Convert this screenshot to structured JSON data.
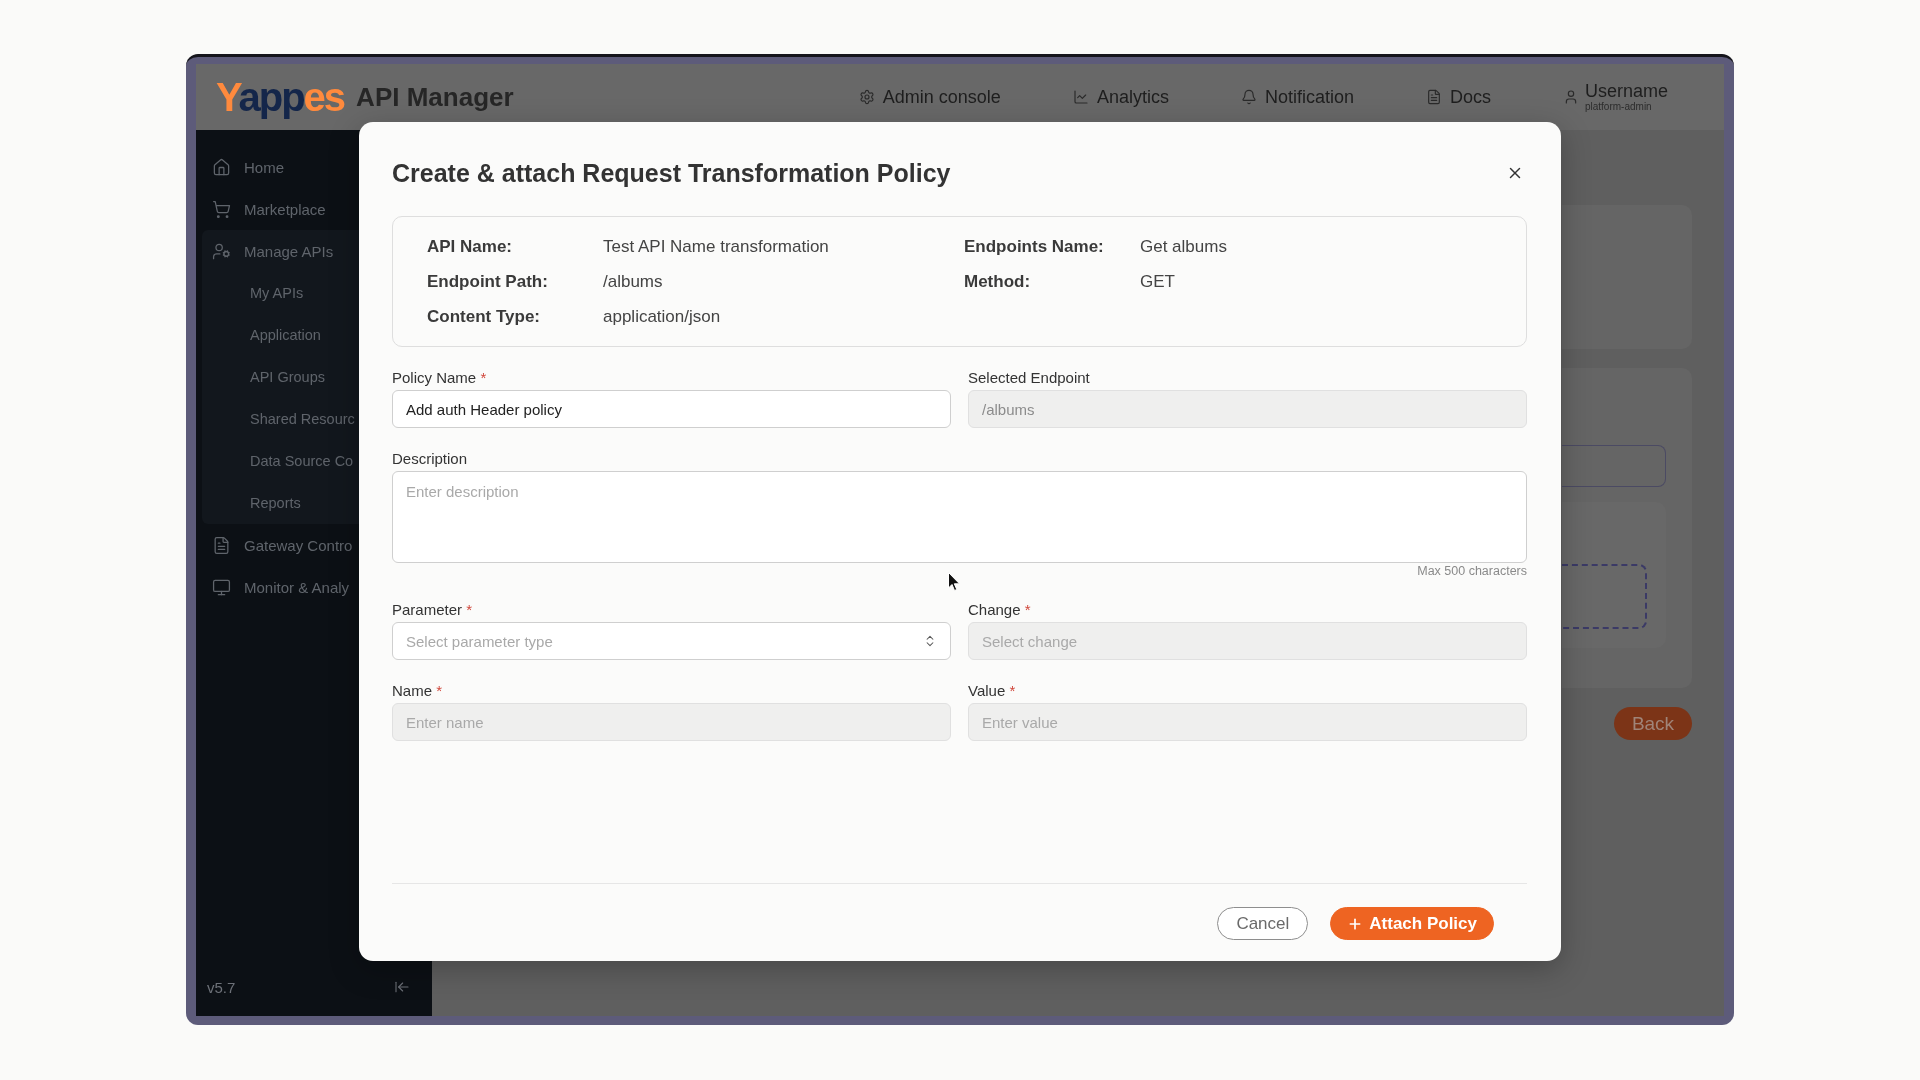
{
  "header": {
    "logo": "Yappes",
    "app_name": "API Manager",
    "nav": [
      {
        "label": "Admin console"
      },
      {
        "label": "Analytics"
      },
      {
        "label": "Notification"
      },
      {
        "label": "Docs"
      }
    ],
    "user": {
      "name": "Username",
      "role": "platform-admin"
    }
  },
  "sidebar": {
    "items": [
      {
        "label": "Home"
      },
      {
        "label": "Marketplace"
      },
      {
        "label": "Manage APIs",
        "expanded": true,
        "children": [
          {
            "label": "My APIs"
          },
          {
            "label": "Application"
          },
          {
            "label": "API Groups"
          },
          {
            "label": "Shared Resourc"
          },
          {
            "label": "Data Source Co"
          },
          {
            "label": "Reports"
          }
        ]
      },
      {
        "label": "Gateway Contro"
      },
      {
        "label": "Monitor & Analy"
      }
    ],
    "version": "v5.7"
  },
  "page_behind": {
    "back_button": "Back"
  },
  "modal": {
    "title": "Create & attach Request Transformation Policy",
    "details": [
      {
        "label": "API Name:",
        "value": "Test API Name transformation"
      },
      {
        "label": "Endpoints Name:",
        "value": "Get albums"
      },
      {
        "label": "Endpoint Path:",
        "value": "/albums"
      },
      {
        "label": "Method:",
        "value": "GET"
      },
      {
        "label": "Content Type:",
        "value": "application/json"
      }
    ],
    "fields": [
      {
        "kind": "input",
        "label": "Policy Name",
        "required_mark": "*",
        "value": "Add auth Header policy",
        "disabled": false
      },
      {
        "kind": "input",
        "label": "Selected Endpoint",
        "value": "/albums",
        "disabled": true
      },
      {
        "kind": "textarea",
        "label": "Description",
        "placeholder": "Enter description",
        "hint": "Max 500 characters",
        "disabled": false
      },
      {
        "kind": "select",
        "label": "Parameter",
        "required_mark": "*",
        "placeholder": "Select parameter type",
        "disabled": false
      },
      {
        "kind": "select",
        "label": "Change",
        "required_mark": "*",
        "placeholder": "Select change",
        "disabled": true
      },
      {
        "kind": "input",
        "label": "Name",
        "required_mark": "*",
        "placeholder": "Enter name",
        "disabled": true
      },
      {
        "kind": "input",
        "label": "Value",
        "required_mark": "*",
        "placeholder": "Enter value",
        "disabled": true
      }
    ],
    "buttons": [
      {
        "label": "Cancel",
        "kind": "secondary"
      },
      {
        "label": "Attach Policy",
        "kind": "primary"
      }
    ]
  }
}
